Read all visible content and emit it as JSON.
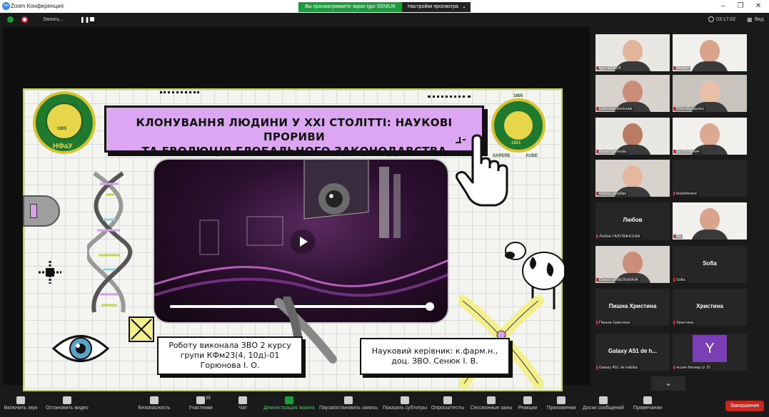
{
  "window": {
    "title": "Zoom Конференция",
    "logo_text": "zm",
    "share_banner": "Вы просматриваете экран Igor SENIUK",
    "view_settings": "Настройки просмотра"
  },
  "topbar": {
    "record_label": "Запись...",
    "time": "03:17:02",
    "view_label": "Вид"
  },
  "slide": {
    "title_line1": "КЛОНУВАННЯ ЛЮДИНИ У XXI  СТОЛІТТІ: НАУКОВІ ПРОРИВИ",
    "title_line2": "ТА ЕВОЛЮЦІЯ ГЛОБАЛЬНОГО ЗАКОНОДАВСТВА",
    "left_logo_text": "НФаУ",
    "left_logo_year": "1805",
    "right_logo_year_top": "1805",
    "right_logo_year": "1921",
    "right_logo_motto_left": "SAPERE",
    "right_logo_motto_right": "AUDE",
    "author_line1": "Роботу виконала ЗВО 2 курсу",
    "author_line2": "групи КФм23(4, 10д)-01",
    "author_line3": "Горюнова І. О.",
    "supervisor_line1": "Науковий керівник: к.фарм.н.,",
    "supervisor_line2": "доц. ЗВО. Сенюк І. В.",
    "video_progress": 0.99
  },
  "participants": [
    {
      "name": "Igor SENIUK",
      "type": "video"
    },
    {
      "name": "Dmytro",
      "type": "video"
    },
    {
      "name": "Світлана Колісник",
      "type": "video"
    },
    {
      "name": "Юля Матвієнко",
      "type": "video"
    },
    {
      "name": "Riyad Qamouta",
      "type": "video"
    },
    {
      "name": "Та Т.Ч.Чупич",
      "type": "video"
    },
    {
      "name": "Олена Щербак",
      "type": "video"
    },
    {
      "name": "Ibrahimome",
      "type": "blank"
    },
    {
      "name": "Любов ГАЛУЗИНСЬКА",
      "type": "text",
      "display": "Любов"
    },
    {
      "name": "Ха",
      "type": "video"
    },
    {
      "name": "Ольга ШАБЕЛЬКИНА",
      "type": "video"
    },
    {
      "name": "Sofia",
      "type": "text",
      "display": "Sofia"
    },
    {
      "name": "Пишна Христина",
      "type": "text",
      "display": "Пишна Христина"
    },
    {
      "name": "Христина",
      "type": "text",
      "display": "Христина"
    },
    {
      "name": "Galaxy A51 de habiba",
      "type": "text",
      "display": "Galaxy A51 de h..."
    },
    {
      "name": "яссин бехзид  гр 15",
      "type": "avatar",
      "display": "Y"
    }
  ],
  "toolbar": {
    "items": [
      {
        "label": "Включить звук",
        "icon": "mic-muted-icon"
      },
      {
        "label": "Остановить видео",
        "icon": "video-camera-icon"
      },
      {
        "label": "Безопасность",
        "icon": "shield-icon"
      },
      {
        "label": "Участники",
        "icon": "participants-icon",
        "count": "39"
      },
      {
        "label": "Чат",
        "icon": "chat-icon"
      },
      {
        "label": "Демонстрация экрана",
        "icon": "share-screen-icon"
      },
      {
        "label": "Пауза/остановить запись",
        "icon": "pause-record-icon"
      },
      {
        "label": "Показать субтитры",
        "icon": "captions-icon"
      },
      {
        "label": "Опросы/тесты",
        "icon": "polls-icon"
      },
      {
        "label": "Сессионные залы",
        "icon": "breakout-rooms-icon"
      },
      {
        "label": "Реакции",
        "icon": "reactions-icon"
      },
      {
        "label": "Приложения",
        "icon": "apps-icon"
      },
      {
        "label": "Доски сообщений",
        "icon": "whiteboard-icon"
      },
      {
        "label": "Примечания",
        "icon": "notes-icon"
      }
    ],
    "end_label": "Завершение"
  },
  "colors": {
    "accent_green": "#1a9b3c",
    "end_red": "#c7261f",
    "slide_title_bg": "#dca6f3",
    "slide_border": "#bfd94a"
  }
}
